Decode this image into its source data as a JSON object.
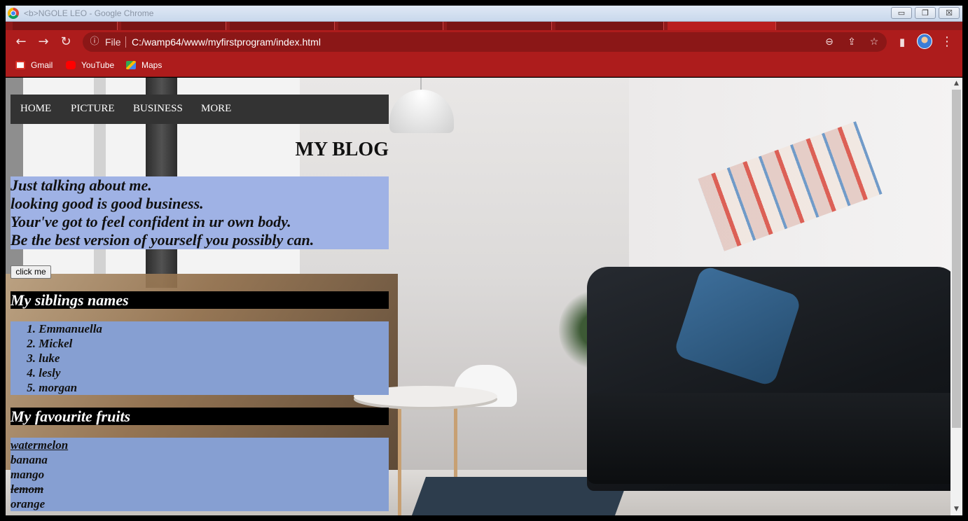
{
  "window": {
    "title": "<b>NGOLE LEO - Google Chrome",
    "minimize": "▭",
    "restore": "❐",
    "close": "☒"
  },
  "toolbar": {
    "back": "←",
    "forward": "→",
    "reload": "↻",
    "info": "ⓘ",
    "file_label": "File",
    "url": "C:/wamp64/www/myfirstprogram/index.html",
    "zoom": "⊖",
    "share": "⇪",
    "star": "☆",
    "sidepanel": "▮",
    "menu": "⋮"
  },
  "bookmarks": [
    {
      "label": "Gmail",
      "icon": "gmail-icon",
      "color": "#ffffff"
    },
    {
      "label": "YouTube",
      "icon": "youtube-icon",
      "color": "#ff0000"
    },
    {
      "label": "Maps",
      "icon": "maps-icon",
      "color": "#34a853"
    }
  ],
  "page": {
    "nav": [
      "HOME",
      "PICTURE",
      "BUSINESS",
      "MORE"
    ],
    "title": "MY BLOG",
    "intro_lines": [
      "Just talking about me.",
      "looking good is good business.",
      "Your've got to feel confident in ur own body.",
      "Be the best version of yourself you possibly can."
    ],
    "button_label": "click me",
    "siblings_heading": "My siblings names",
    "siblings": [
      "Emmanuella",
      "Mickel",
      "luke",
      "lesly",
      "morgan"
    ],
    "fruits_heading": "My favourite fruits",
    "fruits": [
      {
        "name": "watermelon",
        "style": "underline"
      },
      {
        "name": "banana",
        "style": "normal"
      },
      {
        "name": "mango",
        "style": "normal"
      },
      {
        "name": "lemom",
        "style": "strike"
      },
      {
        "name": "orange",
        "style": "normal"
      }
    ]
  },
  "scrollbar": {
    "up": "▲",
    "down": "▼"
  }
}
